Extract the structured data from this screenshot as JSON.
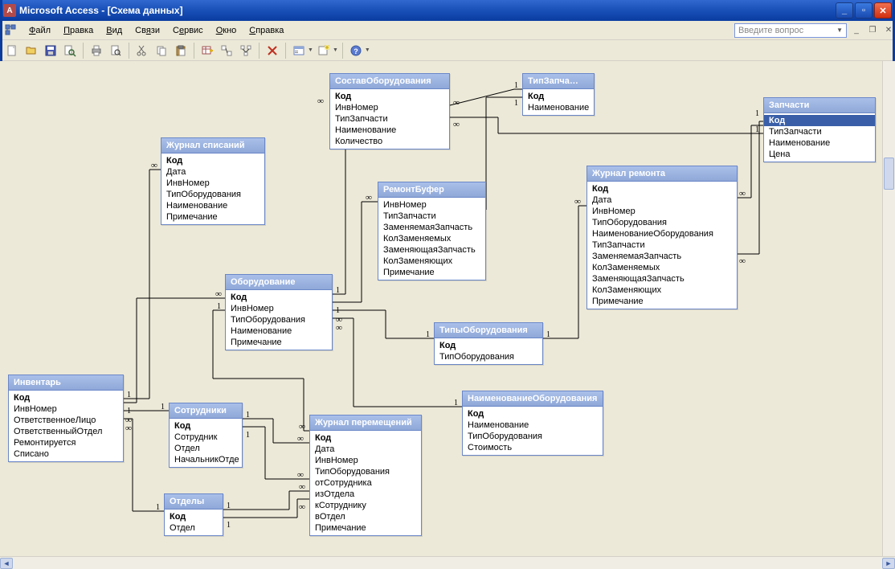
{
  "window": {
    "title": "Microsoft Access - [Схема данных]",
    "question_placeholder": "Введите вопрос"
  },
  "menu": {
    "file": "<u>Ф</u>айл",
    "edit": "<u>П</u>равка",
    "view": "<u>В</u>ид",
    "relations": "Св<u>я</u>зи",
    "service": "С<u>е</u>рвис",
    "window": "<u>О</u>кно",
    "help": "<u>С</u>правка"
  },
  "tables": {
    "sostav": {
      "title": "СоставОборудования",
      "fields": [
        "Код",
        "ИнвНомер",
        "ТипЗапчасти",
        "Наименование",
        "Количество"
      ],
      "pk": [
        0
      ]
    },
    "tipzap": {
      "title": "ТипЗапча…",
      "fields": [
        "Код",
        "Наименование"
      ],
      "pk": [
        0
      ]
    },
    "zapchasti": {
      "title": "Запчасти",
      "fields": [
        "Код",
        "ТипЗапчасти",
        "Наименование",
        "Цена"
      ],
      "pk": [
        0
      ],
      "selected": [
        0
      ]
    },
    "zhspis": {
      "title": "Журнал списаний",
      "fields": [
        "Код",
        "Дата",
        "ИнвНомер",
        "ТипОборудования",
        "Наименование",
        "Примечание"
      ],
      "pk": [
        0
      ]
    },
    "rembuf": {
      "title": "РемонтБуфер",
      "fields": [
        "ИнвНомер",
        "ТипЗапчасти",
        "ЗаменяемаяЗапчасть",
        "КолЗаменяемых",
        "ЗаменяющаяЗапчасть",
        "КолЗаменяющих",
        "Примечание"
      ],
      "pk": []
    },
    "zhrem": {
      "title": "Журнал ремонта",
      "fields": [
        "Код",
        "Дата",
        "ИнвНомер",
        "ТипОборудования",
        "НаименованиеОборудования",
        "ТипЗапчасти",
        "ЗаменяемаяЗапчасть",
        "КолЗаменяемых",
        "ЗаменяющаяЗапчасть",
        "КолЗаменяющих",
        "Примечание"
      ],
      "pk": [
        0
      ]
    },
    "oborud": {
      "title": "Оборудование",
      "fields": [
        "Код",
        "ИнвНомер",
        "ТипОборудования",
        "Наименование",
        "Примечание"
      ],
      "pk": [
        0
      ]
    },
    "tipob": {
      "title": "ТипыОборудования",
      "fields": [
        "Код",
        "ТипОборудования"
      ],
      "pk": [
        0
      ]
    },
    "invent": {
      "title": "Инвентарь",
      "fields": [
        "Код",
        "ИнвНомер",
        "ОтветственноеЛицо",
        "ОтветственныйОтдел",
        "Ремонтируется",
        "Списано"
      ],
      "pk": [
        0
      ]
    },
    "sotr": {
      "title": "Сотрудники",
      "fields": [
        "Код",
        "Сотрудник",
        "Отдел",
        "НачальникОтде"
      ],
      "pk": [
        0
      ]
    },
    "naimob": {
      "title": "НаименованиеОборудования",
      "fields": [
        "Код",
        "Наименование",
        "ТипОборудования",
        "Стоимость"
      ],
      "pk": [
        0
      ]
    },
    "zhperem": {
      "title": "Журнал перемещений",
      "fields": [
        "Код",
        "Дата",
        "ИнвНомер",
        "ТипОборудования",
        "отСотрудника",
        "изОтдела",
        "кСотруднику",
        "вОтдел",
        "Примечание"
      ],
      "pk": [
        0
      ]
    },
    "otdel": {
      "title": "Отделы",
      "fields": [
        "Код",
        "Отдел"
      ],
      "pk": [
        0
      ]
    }
  }
}
